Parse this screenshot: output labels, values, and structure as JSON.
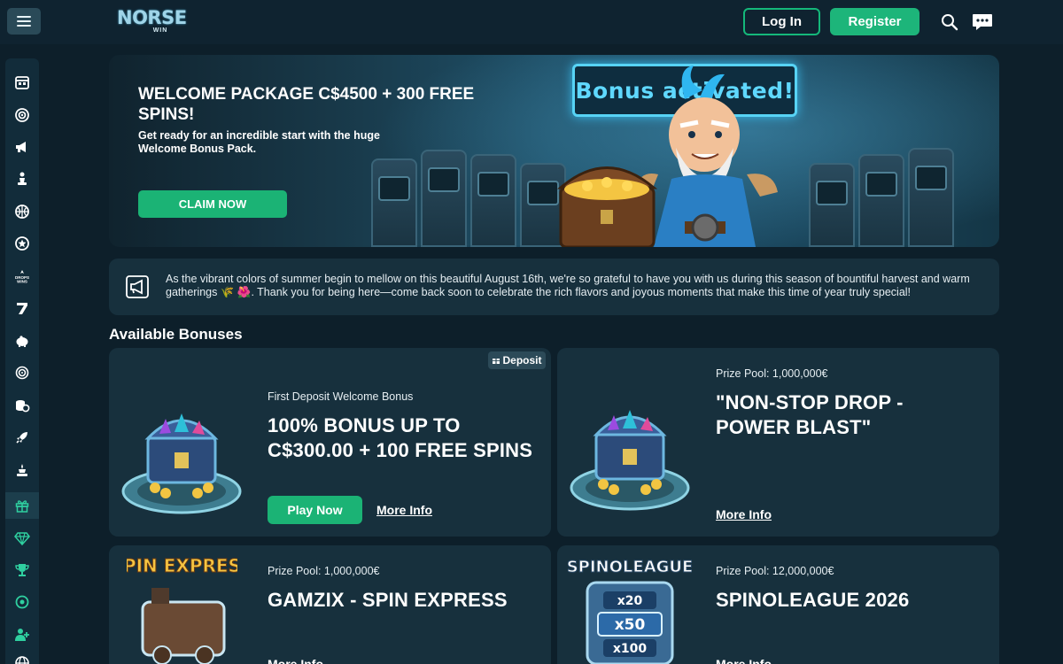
{
  "header": {
    "logo_main": "NORSE",
    "logo_sub": "WIN",
    "login_label": "Log In",
    "register_label": "Register"
  },
  "sidebar": {
    "items": [
      {
        "icon": "calendar-icon"
      },
      {
        "icon": "target-icon"
      },
      {
        "icon": "megaphone-icon"
      },
      {
        "icon": "chess-piece-icon"
      },
      {
        "icon": "basketball-icon"
      },
      {
        "icon": "star-badge-icon"
      },
      {
        "icon": "drops-wins-icon"
      },
      {
        "icon": "seven-icon"
      },
      {
        "icon": "piggy-bank-icon"
      },
      {
        "icon": "radio-target-icon"
      },
      {
        "icon": "coins-icon"
      },
      {
        "icon": "rocket-icon"
      },
      {
        "icon": "trophy-cup-icon"
      },
      {
        "icon": "gift-icon",
        "active": true
      },
      {
        "icon": "diamond-icon"
      },
      {
        "icon": "trophy-icon"
      },
      {
        "icon": "crosshair-icon"
      },
      {
        "icon": "user-plus-icon"
      },
      {
        "icon": "globe-icon"
      }
    ]
  },
  "banner": {
    "title": "WELCOME PACKAGE C$4500 + 300 FREE SPINS!",
    "subtitle": "Get ready for an incredible start with the huge Welcome Bonus Pack.",
    "cta_label": "CLAIM NOW",
    "sign_text": "Bonus activated!"
  },
  "announcement": {
    "text": "As the vibrant colors of summer begin to mellow on this beautiful August 16th, we're so grateful to have you with us during this season of bountiful harvest and warm gatherings 🌾 🌺. Thank you for being here—come back soon to celebrate the rich flavors and joyous moments that make this time of year truly special!"
  },
  "section_title": "Available Bonuses",
  "cards": [
    {
      "badge": "Deposit",
      "subtitle": "First Deposit Welcome Bonus",
      "title": "100% BONUS UP TO C$300.00 + 100 FREE SPINS",
      "play_label": "Play Now",
      "more_label": "More Info"
    },
    {
      "subtitle": "Prize Pool: 1,000,000€",
      "title": "\"NON-STOP DROP - POWER BLAST\"",
      "more_label": "More Info"
    },
    {
      "subtitle": "Prize Pool: 1,000,000€",
      "title": "GAMZIX - SPIN EXPRESS",
      "more_label": "More Info",
      "image_text": "SPIN EXPRESS"
    },
    {
      "subtitle": "Prize Pool: 12,000,000€",
      "title": "SPINOLEAGUE 2026",
      "more_label": "More Info",
      "image_text": "SPINOLEAGUE",
      "multipliers": [
        "x20",
        "x50",
        "x100"
      ]
    }
  ],
  "colors": {
    "page_bg": "#0d1f2a",
    "card_bg": "#17303d",
    "accent_green": "#1db57a"
  }
}
